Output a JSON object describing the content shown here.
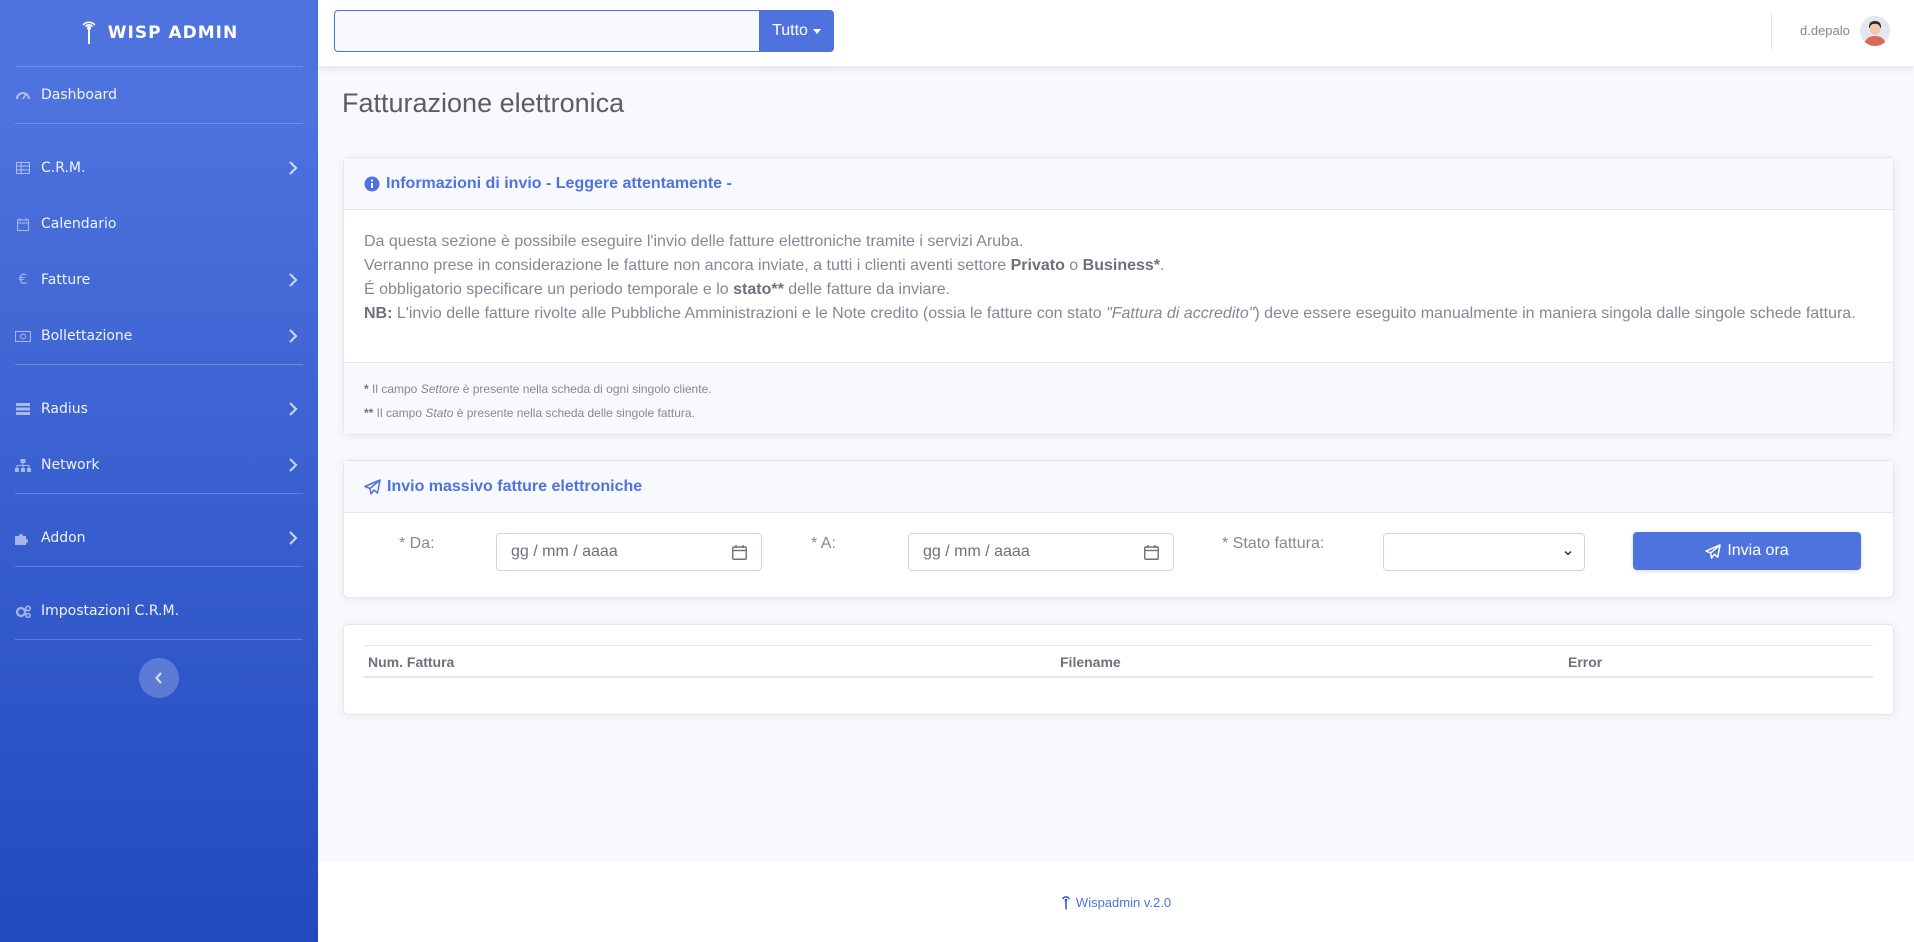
{
  "sidebar": {
    "brand": "WISP ADMIN",
    "items": [
      {
        "label": "Dashboard",
        "icon": "tachometer-icon",
        "submenu": false
      },
      {
        "label": "C.R.M.",
        "icon": "table-icon",
        "submenu": true
      },
      {
        "label": "Calendario",
        "icon": "calendar-icon",
        "submenu": false
      },
      {
        "label": "Fatture",
        "icon": "euro-icon",
        "submenu": true
      },
      {
        "label": "Bollettazione",
        "icon": "money-bill-icon",
        "submenu": true
      },
      {
        "label": "Radius",
        "icon": "server-icon",
        "submenu": true
      },
      {
        "label": "Network",
        "icon": "sitemap-icon",
        "submenu": true
      },
      {
        "label": "Addon",
        "icon": "puzzle-icon",
        "submenu": true
      },
      {
        "label": "Impostazioni C.R.M.",
        "icon": "cogs-icon",
        "submenu": false
      }
    ]
  },
  "topbar": {
    "search_value": "",
    "search_scope": "Tutto",
    "user_name": "d.depalo"
  },
  "page": {
    "title": "Fatturazione elettronica"
  },
  "info_card": {
    "header": "Informazioni di invio - Leggere attentamente -",
    "line1": "Da questa sezione è possibile eseguire l'invio delle fatture elettroniche tramite i servizi Aruba.",
    "line2_a": "Verranno prese in considerazione le fatture non ancora inviate, a tutti i clienti aventi settore ",
    "line2_b": "Privato",
    "line2_c": " o ",
    "line2_d": "Business*",
    "line2_e": ".",
    "line3_a": "É obbligatorio specificare un periodo temporale e lo ",
    "line3_b": "stato**",
    "line3_c": " delle fatture da inviare.",
    "line4_a": "NB:",
    "line4_b": " L'invio delle fatture rivolte alle Pubbliche Amministrazioni e le Note credito (ossia le fatture con stato ",
    "line4_c": "\"Fattura di accredito\"",
    "line4_d": ") deve essere eseguito manualmente in maniera singola dalle singole schede fattura.",
    "foot1_a": "*",
    "foot1_b": " Il campo ",
    "foot1_c": "Settore",
    "foot1_d": " è presente nella scheda di ogni singolo cliente.",
    "foot2_a": "**",
    "foot2_b": " Il campo ",
    "foot2_c": "Stato",
    "foot2_d": " è presente nella scheda delle singole fattura."
  },
  "send_card": {
    "header": "Invio massivo fatture elettroniche",
    "from_label": "* Da:",
    "to_label": "* A:",
    "date_placeholder": "gg / mm / aaaa",
    "status_label": "* Stato fattura:",
    "status_value": "",
    "button": "Invia ora"
  },
  "table": {
    "columns": [
      "Num. Fattura",
      "Filename",
      "Error"
    ]
  },
  "footer": {
    "text": "Wispadmin v.2.0"
  },
  "colors": {
    "primary": "#4e73df",
    "primary_dark": "#224abe",
    "text_muted": "#858796",
    "bg": "#f8f9fc"
  }
}
